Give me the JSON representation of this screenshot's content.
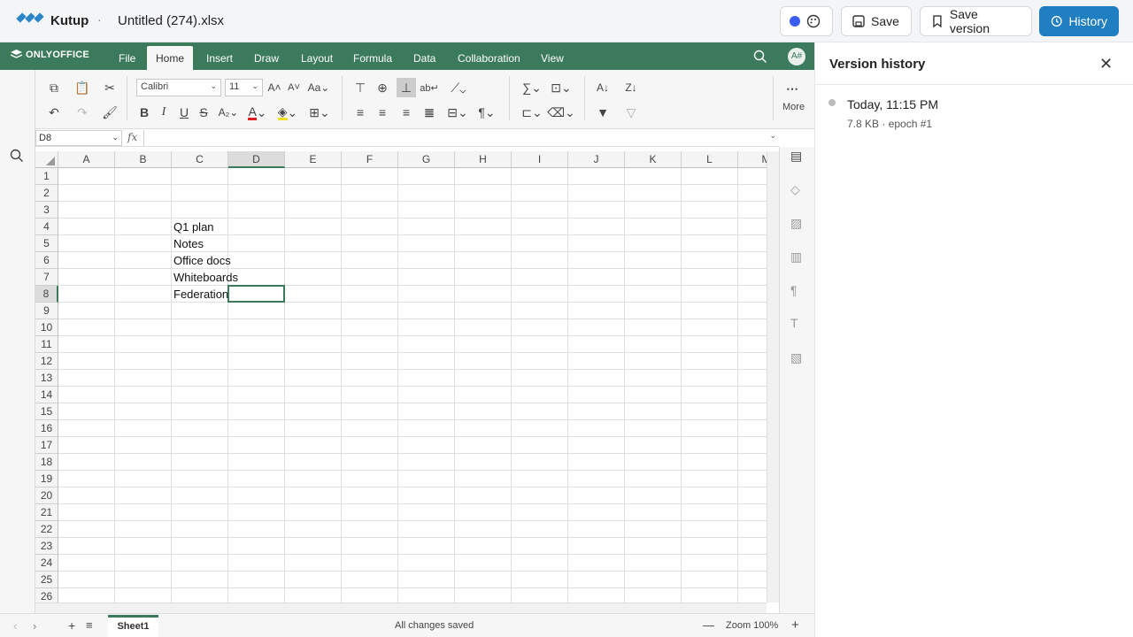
{
  "app": {
    "name": "Kutup",
    "separator": "·",
    "doc_title": "Untitled (274).xlsx"
  },
  "topbar": {
    "save": "Save",
    "save_version": "Save version",
    "history": "History"
  },
  "editor": {
    "brand": "ONLYOFFICE",
    "tabs": [
      "File",
      "Home",
      "Insert",
      "Draw",
      "Layout",
      "Formula",
      "Data",
      "Collaboration",
      "View"
    ],
    "active_tab": "Home",
    "user_initials": "A#",
    "font_name": "Calibri",
    "font_size": "11",
    "more_label": "More",
    "name_box": "D8",
    "fx": "fx"
  },
  "sheet": {
    "columns": [
      "A",
      "B",
      "C",
      "D",
      "E",
      "F",
      "G",
      "H",
      "I",
      "J",
      "K",
      "L",
      "M"
    ],
    "rows": [
      "1",
      "2",
      "3",
      "4",
      "5",
      "6",
      "7",
      "8",
      "9",
      "10",
      "11",
      "12",
      "13",
      "14",
      "15",
      "16",
      "17",
      "18",
      "19",
      "20",
      "21",
      "22",
      "23",
      "24",
      "25",
      "26"
    ],
    "cells": {
      "C4": "Q1 plan",
      "C5": "Notes",
      "C6": "Office docs",
      "C7": "Whiteboards",
      "C8": "Federation"
    },
    "selected": "D8"
  },
  "status": {
    "sheet_tab": "Sheet1",
    "saved": "All changes saved",
    "zoom": "Zoom 100%"
  },
  "version_history": {
    "title": "Version history",
    "close": "✕",
    "entries": [
      {
        "time": "Today, 11:15 PM",
        "meta": "7.8 KB · epoch #1"
      }
    ]
  },
  "colors": {
    "oo_green": "#3c7a5c",
    "history_blue": "#1f7fc0"
  }
}
